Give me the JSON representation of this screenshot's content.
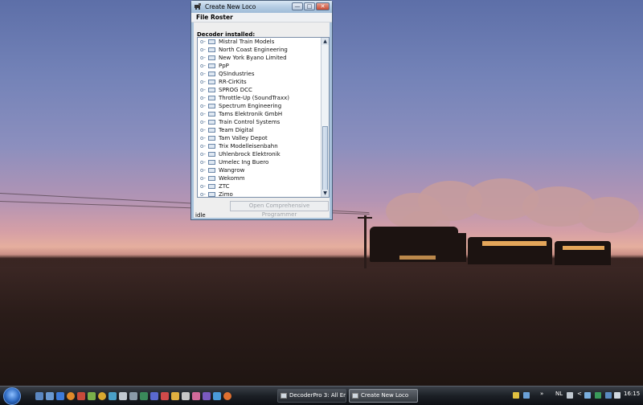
{
  "window": {
    "title": "Create New Loco",
    "minimize_glyph": "—",
    "maximize_glyph": "□",
    "close_glyph": "✕"
  },
  "menu": {
    "file": "File",
    "roster": "Roster"
  },
  "decoder_label": "Decoder installed:",
  "tree": {
    "handle_glyph": "o-",
    "items": [
      "Mistral Train Models",
      "North Coast Engineering",
      "New York Byano Limited",
      "PpP",
      "QSIndustries",
      "RR-CirKits",
      "SPROG DCC",
      "Throttle-Up (SoundTraxx)",
      "Spectrum Engineering",
      "Tams Elektronik GmbH",
      "Train Control Systems",
      "Team Digital",
      "Tam Valley Depot",
      "Trix Modelleisenbahn",
      "Uhlenbrock Elektronik",
      "Umelec Ing Buero",
      "Wangrow",
      "Wekomm",
      "ZTC",
      "Zimo"
    ]
  },
  "program_button": "Open Comprehensive Programmer",
  "status": "idle",
  "taskbar": {
    "tasks": [
      "DecoderPro 3: All En...",
      "Create New Loco"
    ],
    "overflow_glyph": "»",
    "language": "NL",
    "chevron": "<",
    "time": "16:15"
  },
  "colors": {
    "titlebar": "#b5cce3",
    "window_frame": "#aac3dc",
    "taskbar": "#1c2026"
  }
}
